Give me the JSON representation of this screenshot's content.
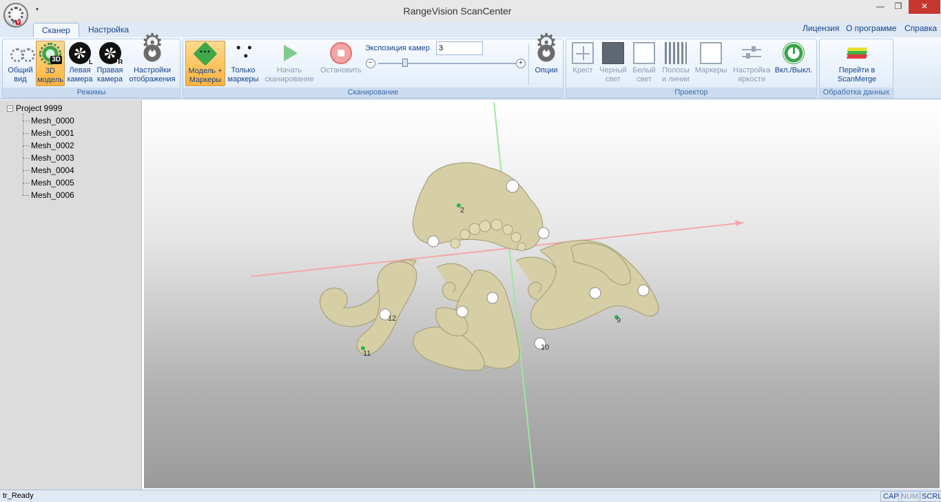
{
  "window": {
    "title": "RangeVision ScanCenter",
    "min": "—",
    "max": "❐",
    "close": "✕"
  },
  "app_menu": {
    "logo_letters": "R",
    "logo_badge": "V",
    "qat_arrow": "▾"
  },
  "tabs": [
    {
      "label": "Сканер",
      "active": true
    },
    {
      "label": "Настройка",
      "active": false
    }
  ],
  "top_links": [
    "Лицензия",
    "О программе",
    "Справка"
  ],
  "groups": {
    "modes": {
      "label": "Режимы",
      "buttons": [
        {
          "label1": "Общий",
          "label2": "вид"
        },
        {
          "label1": "3D",
          "label2": "модель",
          "badge": "3D"
        },
        {
          "label1": "Левая",
          "label2": "камера",
          "badge": "L"
        },
        {
          "label1": "Правая",
          "label2": "камера",
          "badge": "R"
        },
        {
          "label1": "Настройки",
          "label2": "отображения"
        }
      ]
    },
    "scanning": {
      "label": "Сканирование",
      "buttons": [
        {
          "label1": "Модель +",
          "label2": "Маркеры"
        },
        {
          "label1": "Только",
          "label2": "маркеры"
        },
        {
          "label1": "Начать",
          "label2": "сканирование"
        },
        {
          "label1": "Остановить",
          "label2": ""
        },
        {
          "label1": "Опции",
          "label2": ""
        }
      ],
      "exposure_label": "Экспозиция камер",
      "exposure_value": "3",
      "minus": "−",
      "plus": "+"
    },
    "projector": {
      "label": "Проектор",
      "buttons": [
        {
          "label1": "Крест",
          "label2": ""
        },
        {
          "label1": "Черный",
          "label2": "свет"
        },
        {
          "label1": "Белый",
          "label2": "свет"
        },
        {
          "label1": "Полосы",
          "label2": "и линии"
        },
        {
          "label1": "Маркеры",
          "label2": ""
        },
        {
          "label1": "Настройка",
          "label2": "яркости"
        },
        {
          "label1": "Вкл./Выкл.",
          "label2": ""
        }
      ]
    },
    "processing": {
      "label": "Обработка данных",
      "buttons": [
        {
          "label1": "Перейти в",
          "label2": "ScanMerge"
        }
      ]
    }
  },
  "tree": {
    "root": "Project 9999",
    "expander": "−",
    "items": [
      "Mesh_0000",
      "Mesh_0001",
      "Mesh_0002",
      "Mesh_0003",
      "Mesh_0004",
      "Mesh_0005",
      "Mesh_0006"
    ]
  },
  "viewport": {
    "marker_labels": [
      "2",
      "12",
      "9",
      "11",
      "10"
    ],
    "colors": {
      "x_axis": "#f4a8a8",
      "y_axis": "#9ce89c",
      "model": "#d6cfa6",
      "marker": "#2fb24a"
    }
  },
  "status": {
    "text": "tr_Ready",
    "caps": "CAP",
    "num": "NUM",
    "scrl": "SCRL"
  }
}
